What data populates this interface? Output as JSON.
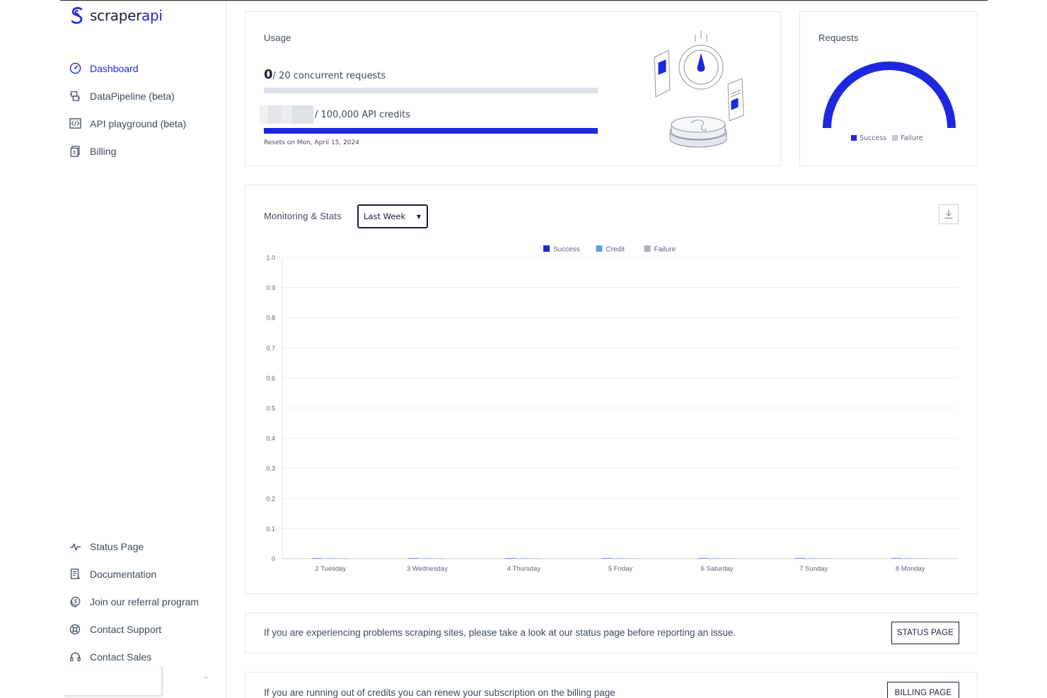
{
  "brand": {
    "name_prefix": "scraper",
    "name_suffix": "api",
    "accent": "#1e27e0"
  },
  "sidebar": {
    "top_items": [
      {
        "label": "Dashboard",
        "icon": "dashboard-gauge-icon",
        "active": true
      },
      {
        "label": "DataPipeline (beta)",
        "icon": "datapipeline-icon"
      },
      {
        "label": "API playground (beta)",
        "icon": "code-playground-icon"
      },
      {
        "label": "Billing",
        "icon": "billing-document-icon"
      }
    ],
    "bottom_items": [
      {
        "label": "Status Page",
        "icon": "pulse-icon"
      },
      {
        "label": "Documentation",
        "icon": "documentation-icon"
      },
      {
        "label": "Join our referral program",
        "icon": "referral-coin-icon"
      },
      {
        "label": "Contact Support",
        "icon": "lifebuoy-icon"
      },
      {
        "label": "Contact Sales",
        "icon": "headset-icon"
      }
    ],
    "collapse_chevron": "^"
  },
  "usage": {
    "title": "Usage",
    "concurrent_value": "0",
    "concurrent_text": "/ 20 concurrent requests",
    "concurrent_fraction": 0,
    "credits_text": "/ 100,000 API credits",
    "credits_fraction": 1.0,
    "resets": "Resets on Mon, April 15, 2024"
  },
  "requests": {
    "title": "Requests",
    "success_fraction": 1.0,
    "legend": [
      "Success",
      "Failure"
    ],
    "colors": {
      "success": "#1e27e0",
      "failure": "#c4c8cf"
    }
  },
  "monitor": {
    "title": "Monitoring & Stats",
    "period_selected": "Last Week",
    "download_icon": "download-icon"
  },
  "chart_data": {
    "type": "bar",
    "categories": [
      "2 Tuesday",
      "3 Wednesday",
      "4 Thursday",
      "5 Friday",
      "6 Saturday",
      "7 Sunday",
      "8 Monday"
    ],
    "series": [
      {
        "name": "Success",
        "color": "#1e27e0",
        "values": [
          0,
          0,
          0,
          0,
          0,
          0,
          0
        ]
      },
      {
        "name": "Credit",
        "color": "#56a6ee",
        "values": [
          0,
          0,
          0,
          0,
          0,
          0,
          0
        ]
      },
      {
        "name": "Failure",
        "color": "#a9b0bb",
        "values": [
          0,
          0,
          0,
          0,
          0,
          0,
          0
        ]
      }
    ],
    "yticks": [
      "0",
      "0.1",
      "0.2",
      "0.3",
      "0.4",
      "0.5",
      "0.6",
      "0.7",
      "0.8",
      "0.9",
      "1.0"
    ],
    "ylim": [
      0,
      1
    ],
    "grid": true,
    "legend_position": "top-center"
  },
  "status_notice": {
    "text": "If you are experiencing problems scraping sites, please take a look at our status page before reporting an issue.",
    "button": "STATUS PAGE"
  },
  "billing_notice": {
    "text": "If you are running out of credits you can renew your subscription on the billing page",
    "button": "BILLING PAGE"
  }
}
